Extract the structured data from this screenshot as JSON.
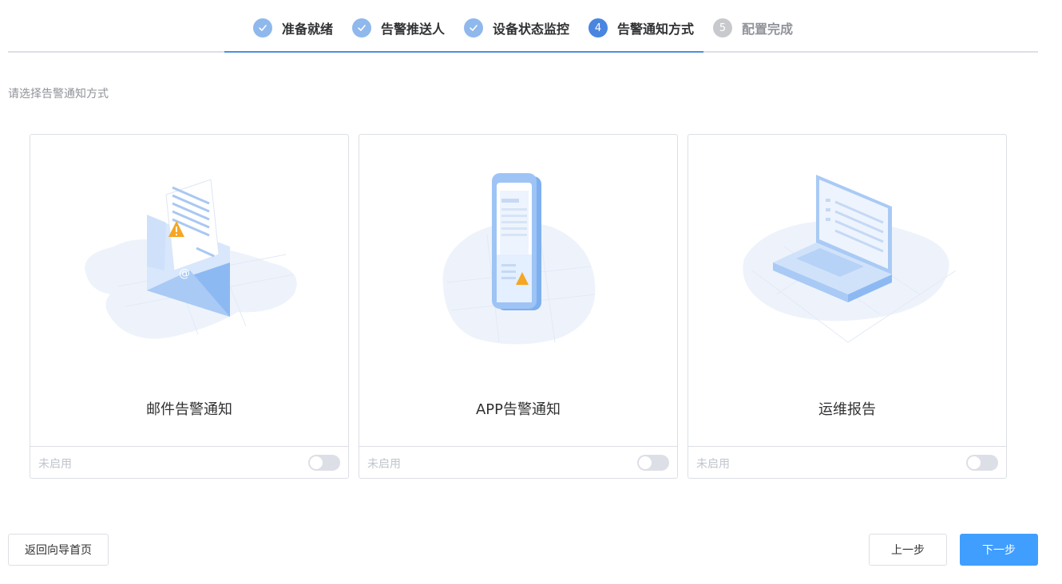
{
  "steps": [
    {
      "label": "准备就绪",
      "state": "done"
    },
    {
      "label": "告警推送人",
      "state": "done"
    },
    {
      "label": "设备状态监控",
      "state": "done"
    },
    {
      "label": "告警通知方式",
      "state": "active",
      "number": "4"
    },
    {
      "label": "配置完成",
      "state": "pending",
      "number": "5"
    }
  ],
  "hint": "请选择告警通知方式",
  "cards": [
    {
      "title": "邮件告警通知",
      "status": "未启用",
      "enabled": false,
      "icon": "email-alert-illustration"
    },
    {
      "title": "APP告警通知",
      "status": "未启用",
      "enabled": false,
      "icon": "phone-alert-illustration"
    },
    {
      "title": "运维报告",
      "status": "未启用",
      "enabled": false,
      "icon": "laptop-report-illustration"
    }
  ],
  "buttons": {
    "back_home": "返回向导首页",
    "prev": "上一步",
    "next": "下一步"
  },
  "colors": {
    "active": "#4a86e0",
    "done": "#8fb8ec",
    "primary": "#409eff"
  }
}
